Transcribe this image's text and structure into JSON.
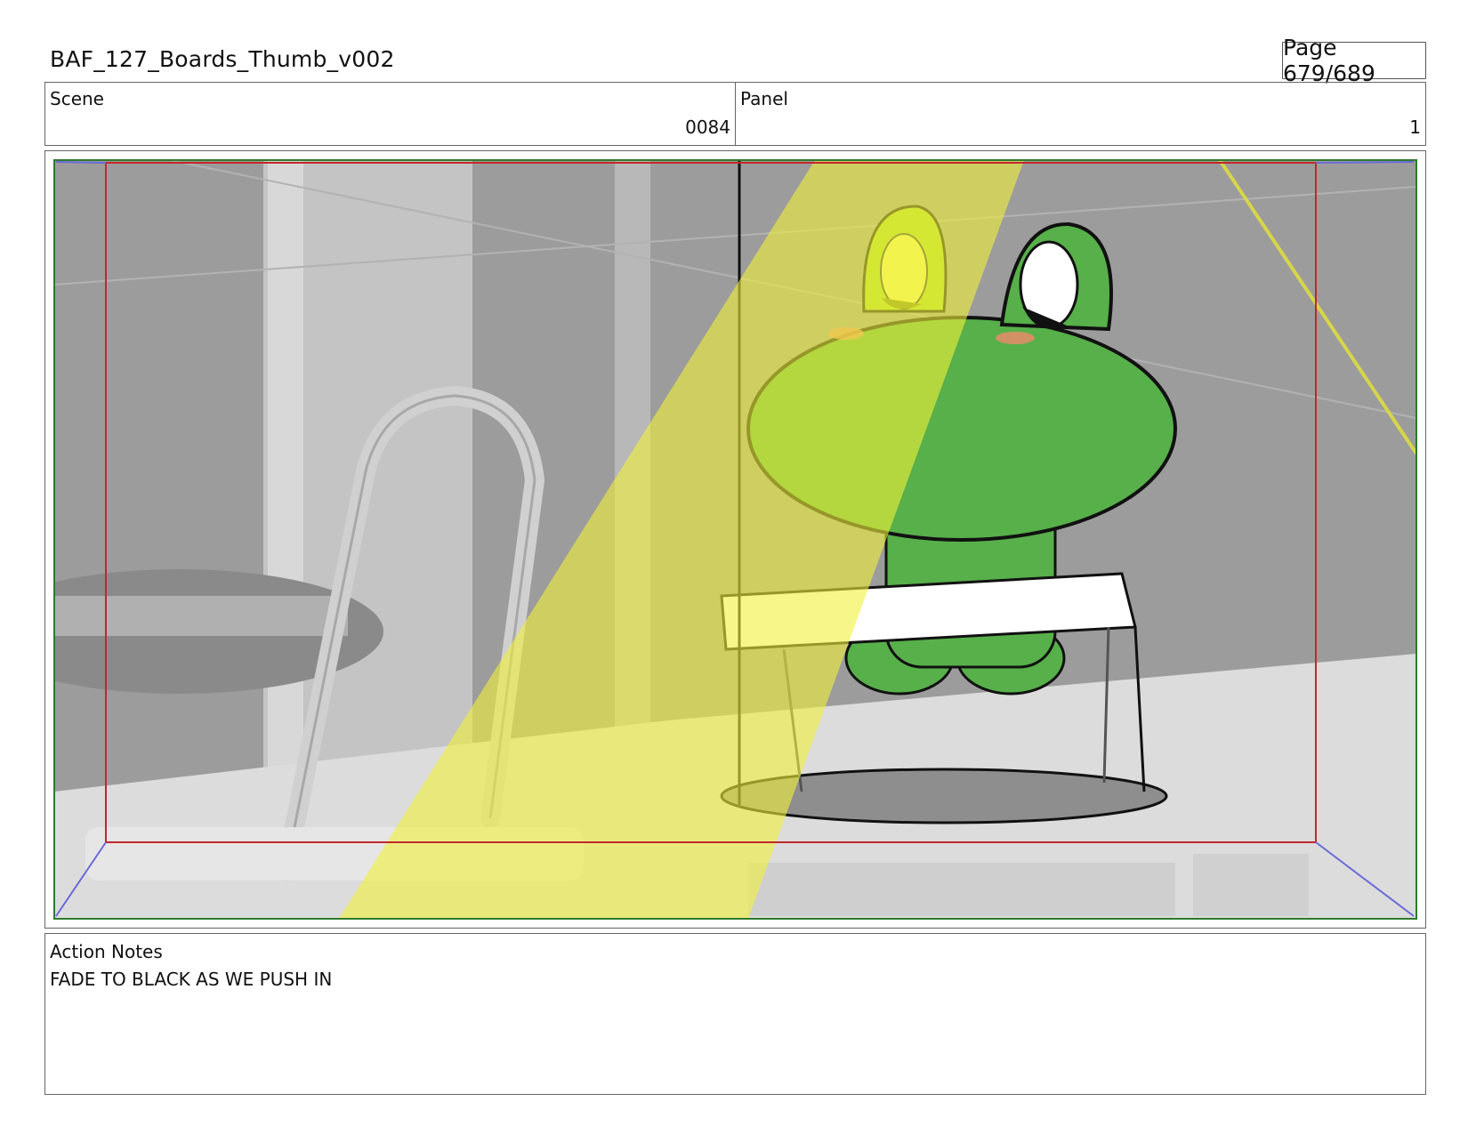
{
  "header": {
    "title": "BAF_127_Boards_Thumb_v002",
    "page": "Page 679/689"
  },
  "info": {
    "scene_label": "Scene",
    "scene_value": "0084",
    "panel_label": "Panel",
    "panel_value": "1"
  },
  "panel_image": {
    "description_icon": "storyboard-frame",
    "colors": {
      "background": "#9c9c9c",
      "floor": "#dcdcdc",
      "spotlight": "#f2f23a",
      "frog_green": "#57b04a",
      "frog_lit": "#a8d62a",
      "safe_frame": "#c0282a",
      "outer_frame": "#2e7a2e"
    }
  },
  "notes": {
    "label": "Action Notes",
    "text": "FADE TO BLACK AS WE PUSH IN"
  }
}
